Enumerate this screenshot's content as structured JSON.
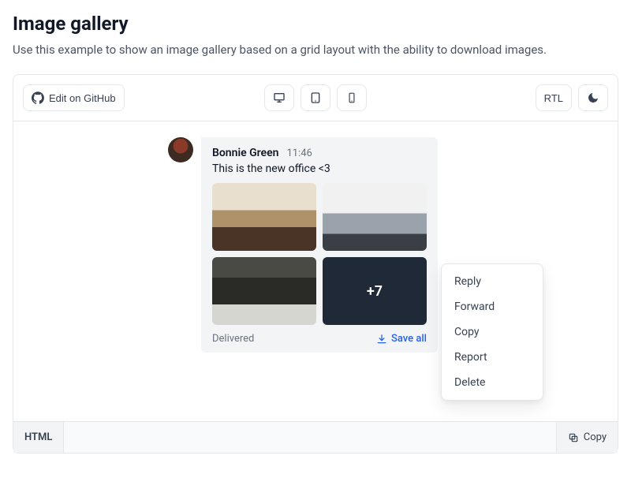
{
  "header": {
    "title": "Image gallery",
    "description": "Use this example to show an image gallery based on a grid layout with the ability to download images."
  },
  "toolbar": {
    "edit_github": "Edit on GitHub",
    "rtl": "RTL"
  },
  "message": {
    "sender": "Bonnie Green",
    "time": "11:46",
    "text": "This is the new office <3",
    "more_count": "+7",
    "status": "Delivered",
    "save_all": "Save all"
  },
  "dropdown": {
    "items": [
      "Reply",
      "Forward",
      "Copy",
      "Report",
      "Delete"
    ]
  },
  "code": {
    "tab": "HTML",
    "copy": "Copy"
  }
}
